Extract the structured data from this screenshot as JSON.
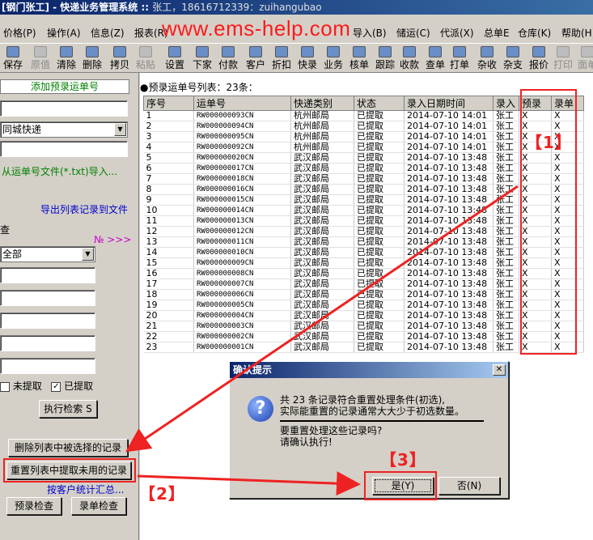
{
  "window": {
    "title_prefix": "[钢门张工] - 快递业务管理系统 :: ",
    "title_user": "张工，18616712339：zuihangubao"
  },
  "watermark": "www.ems-help.com",
  "menu": [
    "价格(P)",
    "操作(A)",
    "信息(Z)",
    "报表(R)",
    "导入(B)",
    "储运(C)",
    "代派(X)",
    "总单E",
    "仓库(K)",
    "帮助(H)"
  ],
  "toolbar": {
    "items": [
      {
        "label": "保存",
        "icon": "save-icon",
        "enabled": true
      },
      {
        "label": "原值",
        "icon": "undo-icon",
        "enabled": false
      },
      {
        "label": "清除",
        "icon": "clear-icon",
        "enabled": true
      },
      {
        "label": "删除",
        "icon": "delete-icon",
        "enabled": true
      },
      {
        "label": "拷贝",
        "icon": "copy-icon",
        "enabled": true
      },
      {
        "label": "粘贴",
        "icon": "paste-icon",
        "enabled": false
      },
      {
        "label": "设置",
        "icon": "settings-icon",
        "enabled": true
      },
      {
        "label": "下家",
        "icon": "downstream-icon",
        "enabled": true
      },
      {
        "label": "付款",
        "icon": "pay-icon",
        "enabled": true
      },
      {
        "label": "客户",
        "icon": "customer-icon",
        "enabled": true
      },
      {
        "label": "折扣",
        "icon": "discount-icon",
        "enabled": true
      },
      {
        "label": "快录",
        "icon": "quick-entry-icon",
        "enabled": true
      },
      {
        "label": "业务",
        "icon": "business-icon",
        "enabled": true
      },
      {
        "label": "核单",
        "icon": "verify-icon",
        "enabled": true
      },
      {
        "label": "跟踪",
        "icon": "track-icon",
        "enabled": true
      },
      {
        "label": "收款",
        "icon": "receive-icon",
        "enabled": true
      },
      {
        "label": "查单",
        "icon": "search-icon",
        "enabled": true
      },
      {
        "label": "打单",
        "icon": "print-waybill-icon",
        "enabled": true
      },
      {
        "label": "杂收",
        "icon": "misc-income-icon",
        "enabled": true
      },
      {
        "label": "杂支",
        "icon": "misc-expense-icon",
        "enabled": true
      },
      {
        "label": "报价",
        "icon": "quote-icon",
        "enabled": true
      },
      {
        "label": "打印",
        "icon": "print-icon",
        "enabled": false
      },
      {
        "label": "面单",
        "icon": "label-icon",
        "enabled": false
      }
    ]
  },
  "left": {
    "add_presort_label": "添加预录运单号",
    "courier_select": "同城快递",
    "import_link": "从运单号文件(*.txt)导入...",
    "export_link": "导出列表记录到文件",
    "section_label": "查",
    "no_link": "№ >>>",
    "scope_select": "全部",
    "unextracted_label": "未提取",
    "extracted_label": "已提取",
    "extracted_checked": "✓",
    "search_button": "执行检索 S",
    "delete_selected_button": "删除列表中被选择的记录",
    "reset_unused_button": "重置列表中提取未用的记录",
    "stats_link": "按客户统计汇总...",
    "presort_check_button": "预录检查",
    "entry_check_button": "录单检查"
  },
  "grid": {
    "caption": "●预录运单号列表：23条：",
    "columns": [
      "序号",
      "运单号",
      "快递类别",
      "状态",
      "录入日期时间",
      "录入",
      "预录",
      "录单"
    ],
    "rows": [
      [
        "1",
        "RW000000093CN",
        "杭州邮局",
        "已提取",
        "2014-07-10 14:01",
        "张工",
        "X",
        "X"
      ],
      [
        "2",
        "RW000000094CN",
        "杭州邮局",
        "已提取",
        "2014-07-10 14:01",
        "张工",
        "X",
        "X"
      ],
      [
        "3",
        "RW000000095CN",
        "杭州邮局",
        "已提取",
        "2014-07-10 14:01",
        "张工",
        "X",
        "X"
      ],
      [
        "4",
        "RW000000092CN",
        "杭州邮局",
        "已提取",
        "2014-07-10 14:01",
        "张工",
        "X",
        "X"
      ],
      [
        "5",
        "RW000000020CN",
        "武汉邮局",
        "已提取",
        "2014-07-10 13:48",
        "张工",
        "X",
        "X"
      ],
      [
        "6",
        "RW000000017CN",
        "武汉邮局",
        "已提取",
        "2014-07-10 13:48",
        "张工",
        "X",
        "X"
      ],
      [
        "7",
        "RW000000018CN",
        "武汉邮局",
        "已提取",
        "2014-07-10 13:48",
        "张工",
        "X",
        "X"
      ],
      [
        "8",
        "RW000000016CN",
        "武汉邮局",
        "已提取",
        "2014-07-10 13:48",
        "张工",
        "X",
        "X"
      ],
      [
        "9",
        "RW000000015CN",
        "武汉邮局",
        "已提取",
        "2014-07-10 13:48",
        "张工",
        "X",
        "X"
      ],
      [
        "10",
        "RW000000014CN",
        "武汉邮局",
        "已提取",
        "2014-07-10 13:48",
        "张工",
        "X",
        "X"
      ],
      [
        "11",
        "RW000000013CN",
        "武汉邮局",
        "已提取",
        "2014-07-10 13:48",
        "张工",
        "X",
        "X"
      ],
      [
        "12",
        "RW000000012CN",
        "武汉邮局",
        "已提取",
        "2014-07-10 13:48",
        "张工",
        "X",
        "X"
      ],
      [
        "13",
        "RW000000011CN",
        "武汉邮局",
        "已提取",
        "2014-07-10 13:48",
        "张工",
        "X",
        "X"
      ],
      [
        "14",
        "RW000000010CN",
        "武汉邮局",
        "已提取",
        "2014-07-10 13:48",
        "张工",
        "X",
        "X"
      ],
      [
        "15",
        "RW000000009CN",
        "武汉邮局",
        "已提取",
        "2014-07-10 13:48",
        "张工",
        "X",
        "X"
      ],
      [
        "16",
        "RW000000008CN",
        "武汉邮局",
        "已提取",
        "2014-07-10 13:48",
        "张工",
        "X",
        "X"
      ],
      [
        "17",
        "RW000000007CN",
        "武汉邮局",
        "已提取",
        "2014-07-10 13:48",
        "张工",
        "X",
        "X"
      ],
      [
        "18",
        "RW000000006CN",
        "武汉邮局",
        "已提取",
        "2014-07-10 13:48",
        "张工",
        "X",
        "X"
      ],
      [
        "19",
        "RW000000005CN",
        "武汉邮局",
        "已提取",
        "2014-07-10 13:48",
        "张工",
        "X",
        "X"
      ],
      [
        "20",
        "RW000000004CN",
        "武汉邮局",
        "已提取",
        "2014-07-10 13:48",
        "张工",
        "X",
        "X"
      ],
      [
        "21",
        "RW000000003CN",
        "武汉邮局",
        "已提取",
        "2014-07-10 13:48",
        "张工",
        "X",
        "X"
      ],
      [
        "22",
        "RW000000002CN",
        "武汉邮局",
        "已提取",
        "2014-07-10 13:48",
        "张工",
        "X",
        "X"
      ],
      [
        "23",
        "RW000000001CN",
        "武汉邮局",
        "已提取",
        "2014-07-10 13:48",
        "张工",
        "X",
        "X"
      ]
    ]
  },
  "dialog": {
    "title": "确认提示",
    "line1": "共 23 条记录符合重置处理条件(初选),",
    "line2": "实际能重置的记录通常大大少于初选数量。",
    "line3": "要重置处理这些记录吗?",
    "line4": "请确认执行!",
    "yes_button": "是(Y)",
    "no_button": "否(N)"
  },
  "annotations": {
    "label1": "【1】",
    "label2": "【2】",
    "label3": "【3】",
    "color": "#ee2222"
  }
}
